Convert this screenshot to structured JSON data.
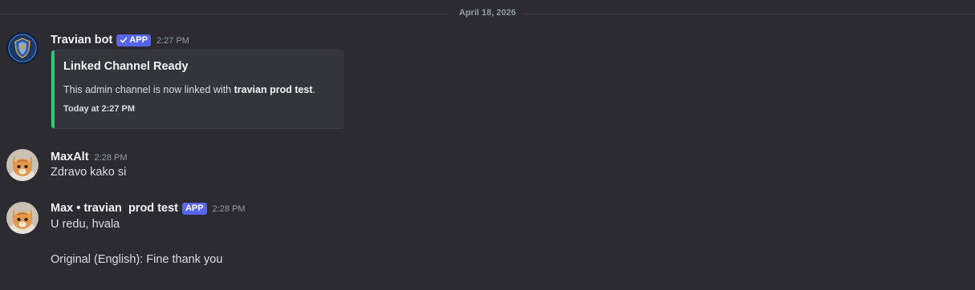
{
  "date_divider": "April 18, 2026",
  "messages": [
    {
      "author": "Travian bot",
      "badge": "APP",
      "time": "2:27 PM",
      "avatar_icon": "shield-crest-icon",
      "embed": {
        "title": "Linked Channel Ready",
        "description_prefix": "This admin channel is now linked with ",
        "description_bold": "travian prod test",
        "description_suffix": ".",
        "footer": "Today at 2:27 PM",
        "accent_color": "#2ecc71"
      }
    },
    {
      "author": "MaxAlt",
      "time": "2:28 PM",
      "avatar_icon": "kitten-avatar-icon",
      "text": "Zdravo kako si"
    },
    {
      "author": "Max • travian  prod test",
      "badge": "APP",
      "time": "2:28 PM",
      "avatar_icon": "kitten-avatar-icon",
      "lines": [
        "U redu, hvala",
        "Original (English): Fine thank you"
      ]
    }
  ],
  "colors": {
    "background": "#2b2b31",
    "app_badge": "#5865f2",
    "embed_background": "#34353b"
  }
}
